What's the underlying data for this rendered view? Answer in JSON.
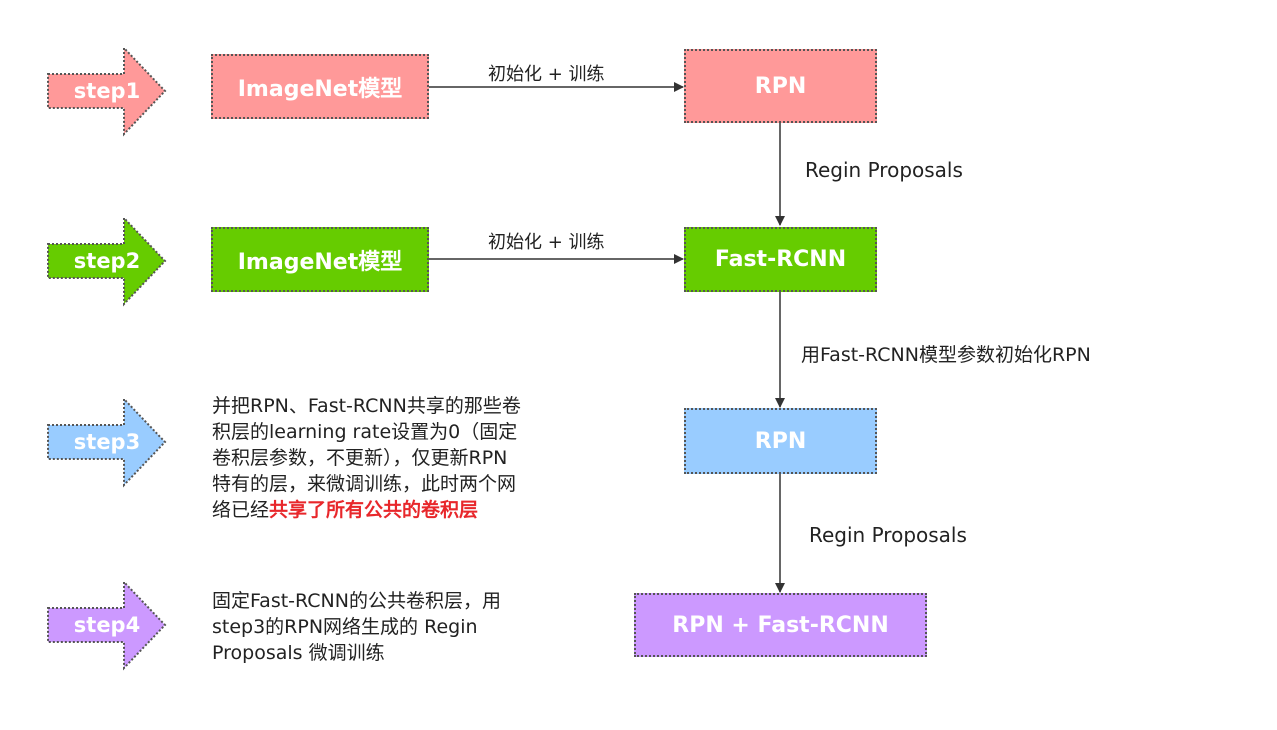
{
  "colors": {
    "step1": "#ff9999",
    "step2": "#66cc00",
    "step3": "#99ccff",
    "step4": "#cc99ff",
    "connector": "#333333",
    "highlight": "#e8272b"
  },
  "steps": [
    {
      "label": "step1"
    },
    {
      "label": "step2"
    },
    {
      "label": "step3"
    },
    {
      "label": "step4"
    }
  ],
  "boxes": {
    "imagenet1": "ImageNet模型",
    "rpn1": "RPN",
    "imagenet2": "ImageNet模型",
    "fast_rcnn": "Fast-RCNN",
    "rpn3": "RPN",
    "rpn_fast_rcnn": "RPN + Fast-RCNN"
  },
  "edges": {
    "init_train_1": "初始化 + 训练",
    "init_train_2": "初始化 + 训练",
    "regin_proposals_1": "Regin Proposals",
    "init_rpn_from_fast": "用Fast-RCNN模型参数初始化RPN",
    "regin_proposals_2": "Regin Proposals"
  },
  "descriptions": {
    "step3": {
      "lines": [
        "并把RPN、Fast-RCNN共享的那些卷",
        "积层的learning rate设置为0（固定",
        "卷积层参数，不更新），仅更新RPN",
        "特有的层，来微调训练，此时两个网"
      ],
      "last_prefix": "络已经",
      "last_highlight": "共享了所有公共的卷积层"
    },
    "step4": {
      "lines": [
        "固定Fast-RCNN的公共卷积层，用",
        "step3的RPN网络生成的 Regin",
        "Proposals 微调训练"
      ]
    }
  }
}
